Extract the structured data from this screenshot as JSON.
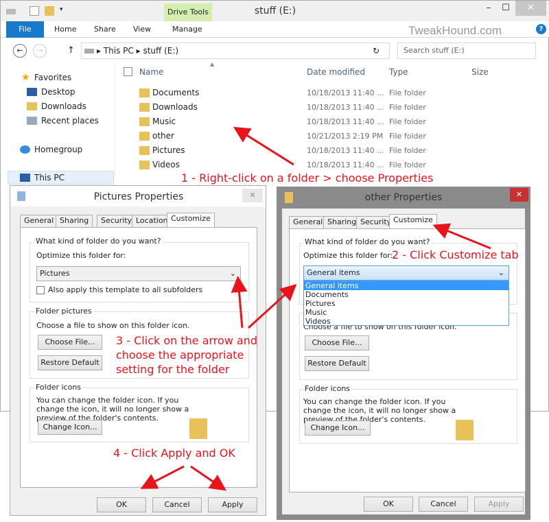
{
  "explorer": {
    "title": "stuff (E:)",
    "context_tab": "Drive Tools",
    "ribbon_tabs": [
      "File",
      "Home",
      "Share",
      "View",
      "Manage"
    ],
    "watermark": "TweakHound.com",
    "breadcrumb": [
      "This PC",
      "stuff (E:)"
    ],
    "search_placeholder": "Search stuff (E:)",
    "columns": {
      "name": "Name",
      "date": "Date modified",
      "type": "Type",
      "size": "Size"
    },
    "nav": {
      "favorites": "Favorites",
      "desktop": "Desktop",
      "downloads": "Downloads",
      "recent": "Recent places",
      "homegroup": "Homegroup",
      "thispc": "This PC"
    },
    "rows": [
      {
        "name": "Documents",
        "date": "10/18/2013 11:40 ...",
        "type": "File folder"
      },
      {
        "name": "Downloads",
        "date": "10/18/2013 11:40 ...",
        "type": "File folder"
      },
      {
        "name": "Music",
        "date": "10/18/2013 11:40 ...",
        "type": "File folder"
      },
      {
        "name": "other",
        "date": "10/21/2013 2:19 PM",
        "type": "File folder"
      },
      {
        "name": "Pictures",
        "date": "10/18/2013 11:40 ...",
        "type": "File folder"
      },
      {
        "name": "Videos",
        "date": "10/18/2013 11:40 ...",
        "type": "File folder"
      }
    ]
  },
  "pictures_dialog": {
    "title": "Pictures Properties",
    "tabs": [
      "General",
      "Sharing",
      "Security",
      "Location",
      "Customize"
    ],
    "group1": "What kind of folder do you want?",
    "optimize_label": "Optimize this folder for:",
    "optimize_value": "Pictures",
    "subfolders": "Also apply this template to all subfolders",
    "group2": "Folder pictures",
    "choose_text": "Choose a file to show on this folder icon.",
    "choose_file": "Choose File...",
    "restore": "Restore Default",
    "group3": "Folder icons",
    "icons_text": "You can change the folder icon. If you change the icon, it will no longer show a preview of the folder's contents.",
    "change_icon": "Change Icon...",
    "ok": "OK",
    "cancel": "Cancel",
    "apply": "Apply"
  },
  "other_dialog": {
    "title": "other Properties",
    "tabs": [
      "General",
      "Sharing",
      "Security",
      "Customize"
    ],
    "group1": "What kind of folder do you want?",
    "optimize_label": "Optimize this folder for:",
    "optimize_value": "General items",
    "options": [
      "General items",
      "Documents",
      "Pictures",
      "Music",
      "Videos"
    ],
    "choose_text": "Choose a file to show on this folder icon.",
    "choose_file": "Choose File...",
    "restore": "Restore Default",
    "group3": "Folder icons",
    "icons_text": "You can change the folder icon. If you change the icon, it will no longer show a preview of the folder's contents.",
    "change_icon": "Change Icon...",
    "ok": "OK",
    "cancel": "Cancel",
    "apply": "Apply"
  },
  "annotations": {
    "step1": "1 - Right-click on a folder > choose Properties",
    "step2": "2 - Click Customize tab",
    "step3": "3 - Click on the arrow and choose the appropriate setting for the folder",
    "step4": "4 - Click Apply and OK"
  },
  "colors": {
    "accent": "#1979ca",
    "annotation": "#e8141a",
    "close": "#c7312f",
    "drive_tools": "#d4eeb0"
  }
}
